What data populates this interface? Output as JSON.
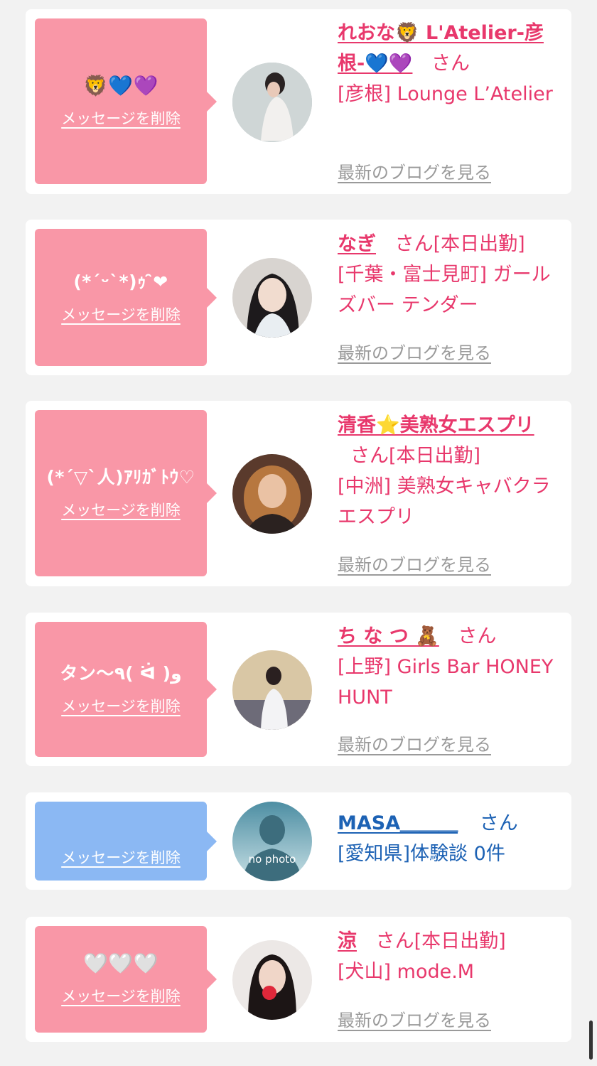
{
  "delete_label": "メッセージを削除",
  "blog_label": "最新のブログを見る",
  "entries": [
    {
      "message": "🦁💙💜",
      "name": "れおな🦁 L'Atelier-彦根-💙💜",
      "san": "さん",
      "shop": "[彦根] Lounge L’Atelier"
    },
    {
      "message": "(*´ᵕ`*)ｩ ̑̑❤︎",
      "name": "なぎ",
      "san": "さん[本日出勤]",
      "shop": "[千葉・富士見町] ガールズバー テンダー"
    },
    {
      "message": "(*´▽`人)ｱﾘｶﾞﾄｳ♡",
      "name": "清香⭐️美熟女エスプリ",
      "san": "さん[本日出勤]",
      "shop": "[中洲] 美熟女キャバクラ エスプリ"
    },
    {
      "message": "タン〜٩( ᐛ )و",
      "name": "ち な つ 🧸",
      "san": "さん",
      "shop": "[上野] Girls Bar HONEY HUNT"
    },
    {
      "message": "",
      "name": "MASA＿＿＿",
      "san": "さん",
      "shop": "[愛知県]体験談 0件",
      "avatar_text": "no photo"
    },
    {
      "message": "🤍🤍🤍",
      "name": "涼",
      "san": "さん[本日出勤]",
      "shop": "[犬山] mode.M"
    }
  ],
  "colors": {
    "pink_bubble": "#f997a7",
    "blue_bubble": "#8bb8f3",
    "pink_text": "#e8386c",
    "blue_text": "#1d62b4",
    "muted": "#9a9a9a"
  }
}
